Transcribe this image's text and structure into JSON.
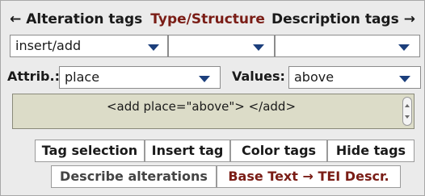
{
  "header": {
    "left_arrow": "←",
    "alteration_tags": "Alteration tags",
    "type_structure": "Type/Structure",
    "description_tags": "Description tags",
    "right_arrow": "→"
  },
  "row1": {
    "select1_value": "insert/add",
    "select2_value": "",
    "select3_value": ""
  },
  "row2": {
    "attrib_label": "Attrib.:",
    "attrib_value": "place",
    "values_label": "Values:",
    "values_value": "above"
  },
  "preview": {
    "code": "<add place=\"above\"> </add>"
  },
  "buttons": {
    "tag_selection": "Tag selection",
    "insert_tag": "Insert tag",
    "color_tags": "Color tags",
    "hide_tags": "Hide tags",
    "describe_alterations": "Describe alterations",
    "base_text_tei": "Base Text → TEI Descr."
  },
  "colors": {
    "accent_red": "#7a1d16",
    "dropdown_arrow": "#1c3f7c",
    "preview_bg": "#dcdcc8"
  }
}
